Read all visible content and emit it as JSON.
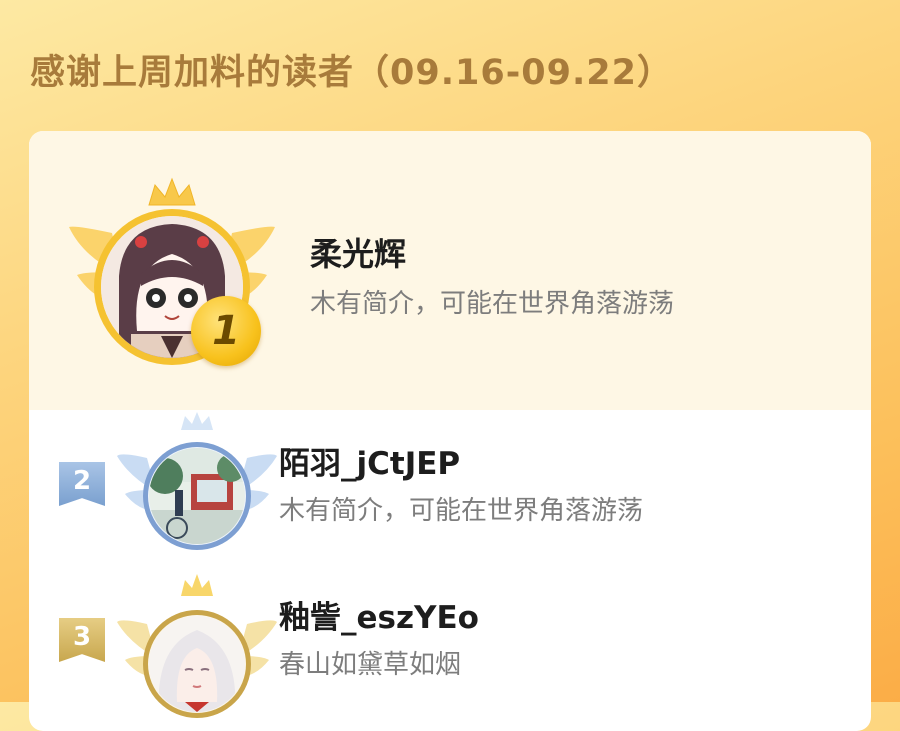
{
  "page": {
    "title": "感谢上周加料的读者（09.16-09.22）"
  },
  "colors": {
    "title": "#a87b3b",
    "gold_ring": "#f5c231",
    "silver_ring": "#7d9fd2",
    "bronze_ring": "#c9a54a"
  },
  "readers": [
    {
      "rank": "1",
      "name": "柔光辉",
      "bio": "木有简介，可能在世界角落游荡",
      "frame_icon": "gold-crown-wings-icon"
    },
    {
      "rank": "2",
      "name": "陌羽_jCtJEP",
      "bio": "木有简介，可能在世界角落游荡",
      "frame_icon": "silver-crown-wings-icon"
    },
    {
      "rank": "3",
      "name": "釉訾_eszYEo",
      "bio": "春山如黛草如烟",
      "frame_icon": "bronze-crown-wings-icon"
    }
  ]
}
